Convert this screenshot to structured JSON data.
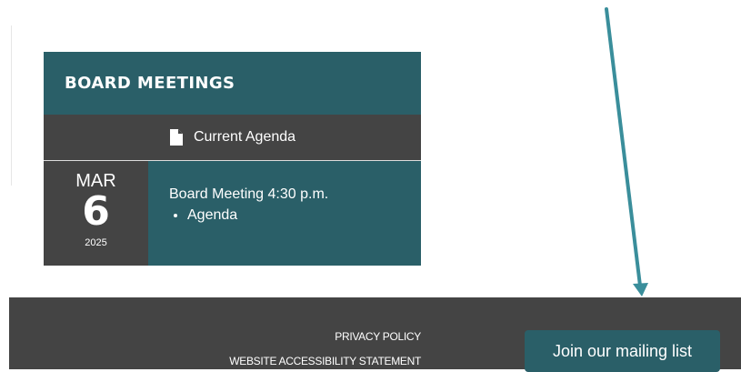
{
  "board": {
    "title": "BOARD MEETINGS",
    "agenda_label": "Current Agenda",
    "event": {
      "month": "MAR",
      "day": "6",
      "year": "2025",
      "title": "Board Meeting 4:30 p.m.",
      "links": [
        "Agenda"
      ]
    }
  },
  "footer": {
    "privacy_policy": "PRIVACY POLICY",
    "accessibility_statement": "WEBSITE ACCESSIBILITY STATEMENT",
    "mailing_list": "Join our mailing list"
  },
  "colors": {
    "teal": "#2a5f68",
    "dark_gray": "#444444",
    "arrow": "#3a8e9b"
  },
  "icons": [
    "document-icon",
    "arrow-annotation"
  ]
}
